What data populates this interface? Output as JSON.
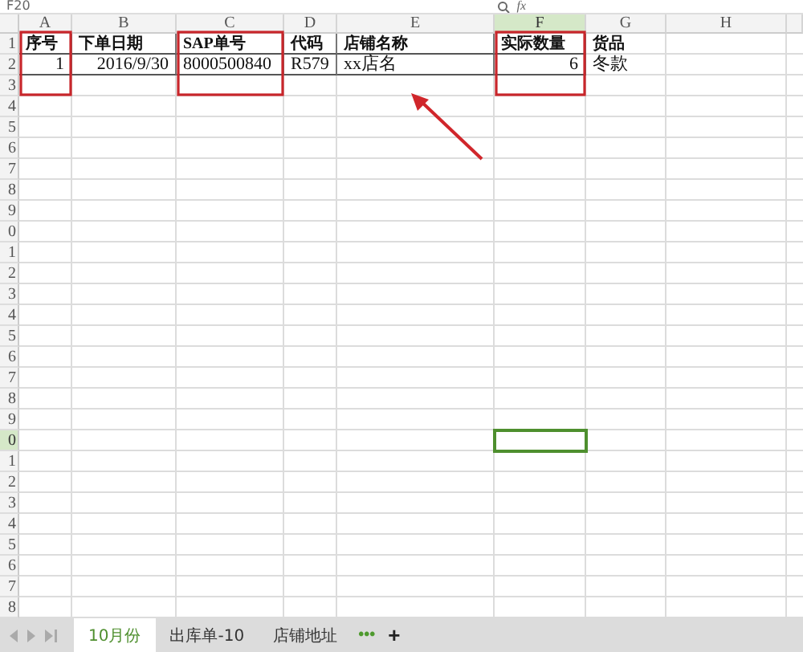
{
  "formula_bar": {
    "name_box": "F20",
    "function_label": "fx"
  },
  "columns": [
    {
      "label": "A",
      "selected": false,
      "boxed": true
    },
    {
      "label": "B",
      "selected": false,
      "boxed": false
    },
    {
      "label": "C",
      "selected": false,
      "boxed": true
    },
    {
      "label": "D",
      "selected": false,
      "boxed": false
    },
    {
      "label": "E",
      "selected": false,
      "boxed": false
    },
    {
      "label": "F",
      "selected": true,
      "boxed": true
    },
    {
      "label": "G",
      "selected": false,
      "boxed": false
    },
    {
      "label": "H",
      "selected": false,
      "boxed": false
    }
  ],
  "annotation_arrow": true,
  "rows": [
    {
      "label": "1",
      "selected": false,
      "kind": "header",
      "cells": [
        {
          "text": "序号",
          "numeric": false,
          "bordered": true
        },
        {
          "text": "下单日期",
          "numeric": false,
          "bordered": true
        },
        {
          "text": "SAP单号",
          "numeric": false,
          "bordered": true
        },
        {
          "text": "代码",
          "numeric": false,
          "bordered": true
        },
        {
          "text": "店铺名称",
          "numeric": false,
          "bordered": true
        },
        {
          "text": "实际数量",
          "numeric": false,
          "bordered": true
        },
        {
          "text": "货品",
          "numeric": false,
          "bordered": false
        }
      ]
    },
    {
      "label": "2",
      "selected": false,
      "kind": "data",
      "cells": [
        {
          "text": "1",
          "numeric": true,
          "bordered": true
        },
        {
          "text": "2016/9/30",
          "numeric": true,
          "bordered": true
        },
        {
          "text": "8000500840",
          "numeric": false,
          "bordered": true
        },
        {
          "text": "R579",
          "numeric": false,
          "bordered": true
        },
        {
          "text": "xx店名",
          "numeric": false,
          "bordered": true
        },
        {
          "text": "6",
          "numeric": true,
          "bordered": true
        },
        {
          "text": "冬款",
          "numeric": false,
          "bordered": false
        }
      ]
    },
    {
      "label": "3",
      "selected": false
    },
    {
      "label": "4",
      "selected": false
    },
    {
      "label": "5",
      "selected": false
    },
    {
      "label": "6",
      "selected": false
    },
    {
      "label": "7",
      "selected": false
    },
    {
      "label": "8",
      "selected": false
    },
    {
      "label": "9",
      "selected": false
    },
    {
      "label": "0",
      "selected": false
    },
    {
      "label": "1",
      "selected": false
    },
    {
      "label": "2",
      "selected": false
    },
    {
      "label": "3",
      "selected": false
    },
    {
      "label": "4",
      "selected": false
    },
    {
      "label": "5",
      "selected": false
    },
    {
      "label": "6",
      "selected": false
    },
    {
      "label": "7",
      "selected": false
    },
    {
      "label": "8",
      "selected": false
    },
    {
      "label": "9",
      "selected": false
    },
    {
      "label": "0",
      "selected": true
    },
    {
      "label": "1",
      "selected": false
    },
    {
      "label": "2",
      "selected": false
    },
    {
      "label": "3",
      "selected": false
    },
    {
      "label": "4",
      "selected": false
    },
    {
      "label": "5",
      "selected": false
    },
    {
      "label": "6",
      "selected": false
    },
    {
      "label": "7",
      "selected": false
    },
    {
      "label": "8",
      "selected": false
    }
  ],
  "sheet_tabs": [
    {
      "label": "10月份",
      "selected": true
    },
    {
      "label": "出库单-10",
      "selected": false
    },
    {
      "label": "店铺地址",
      "selected": false
    }
  ],
  "more_tabs": "•••",
  "add_tab": "+"
}
